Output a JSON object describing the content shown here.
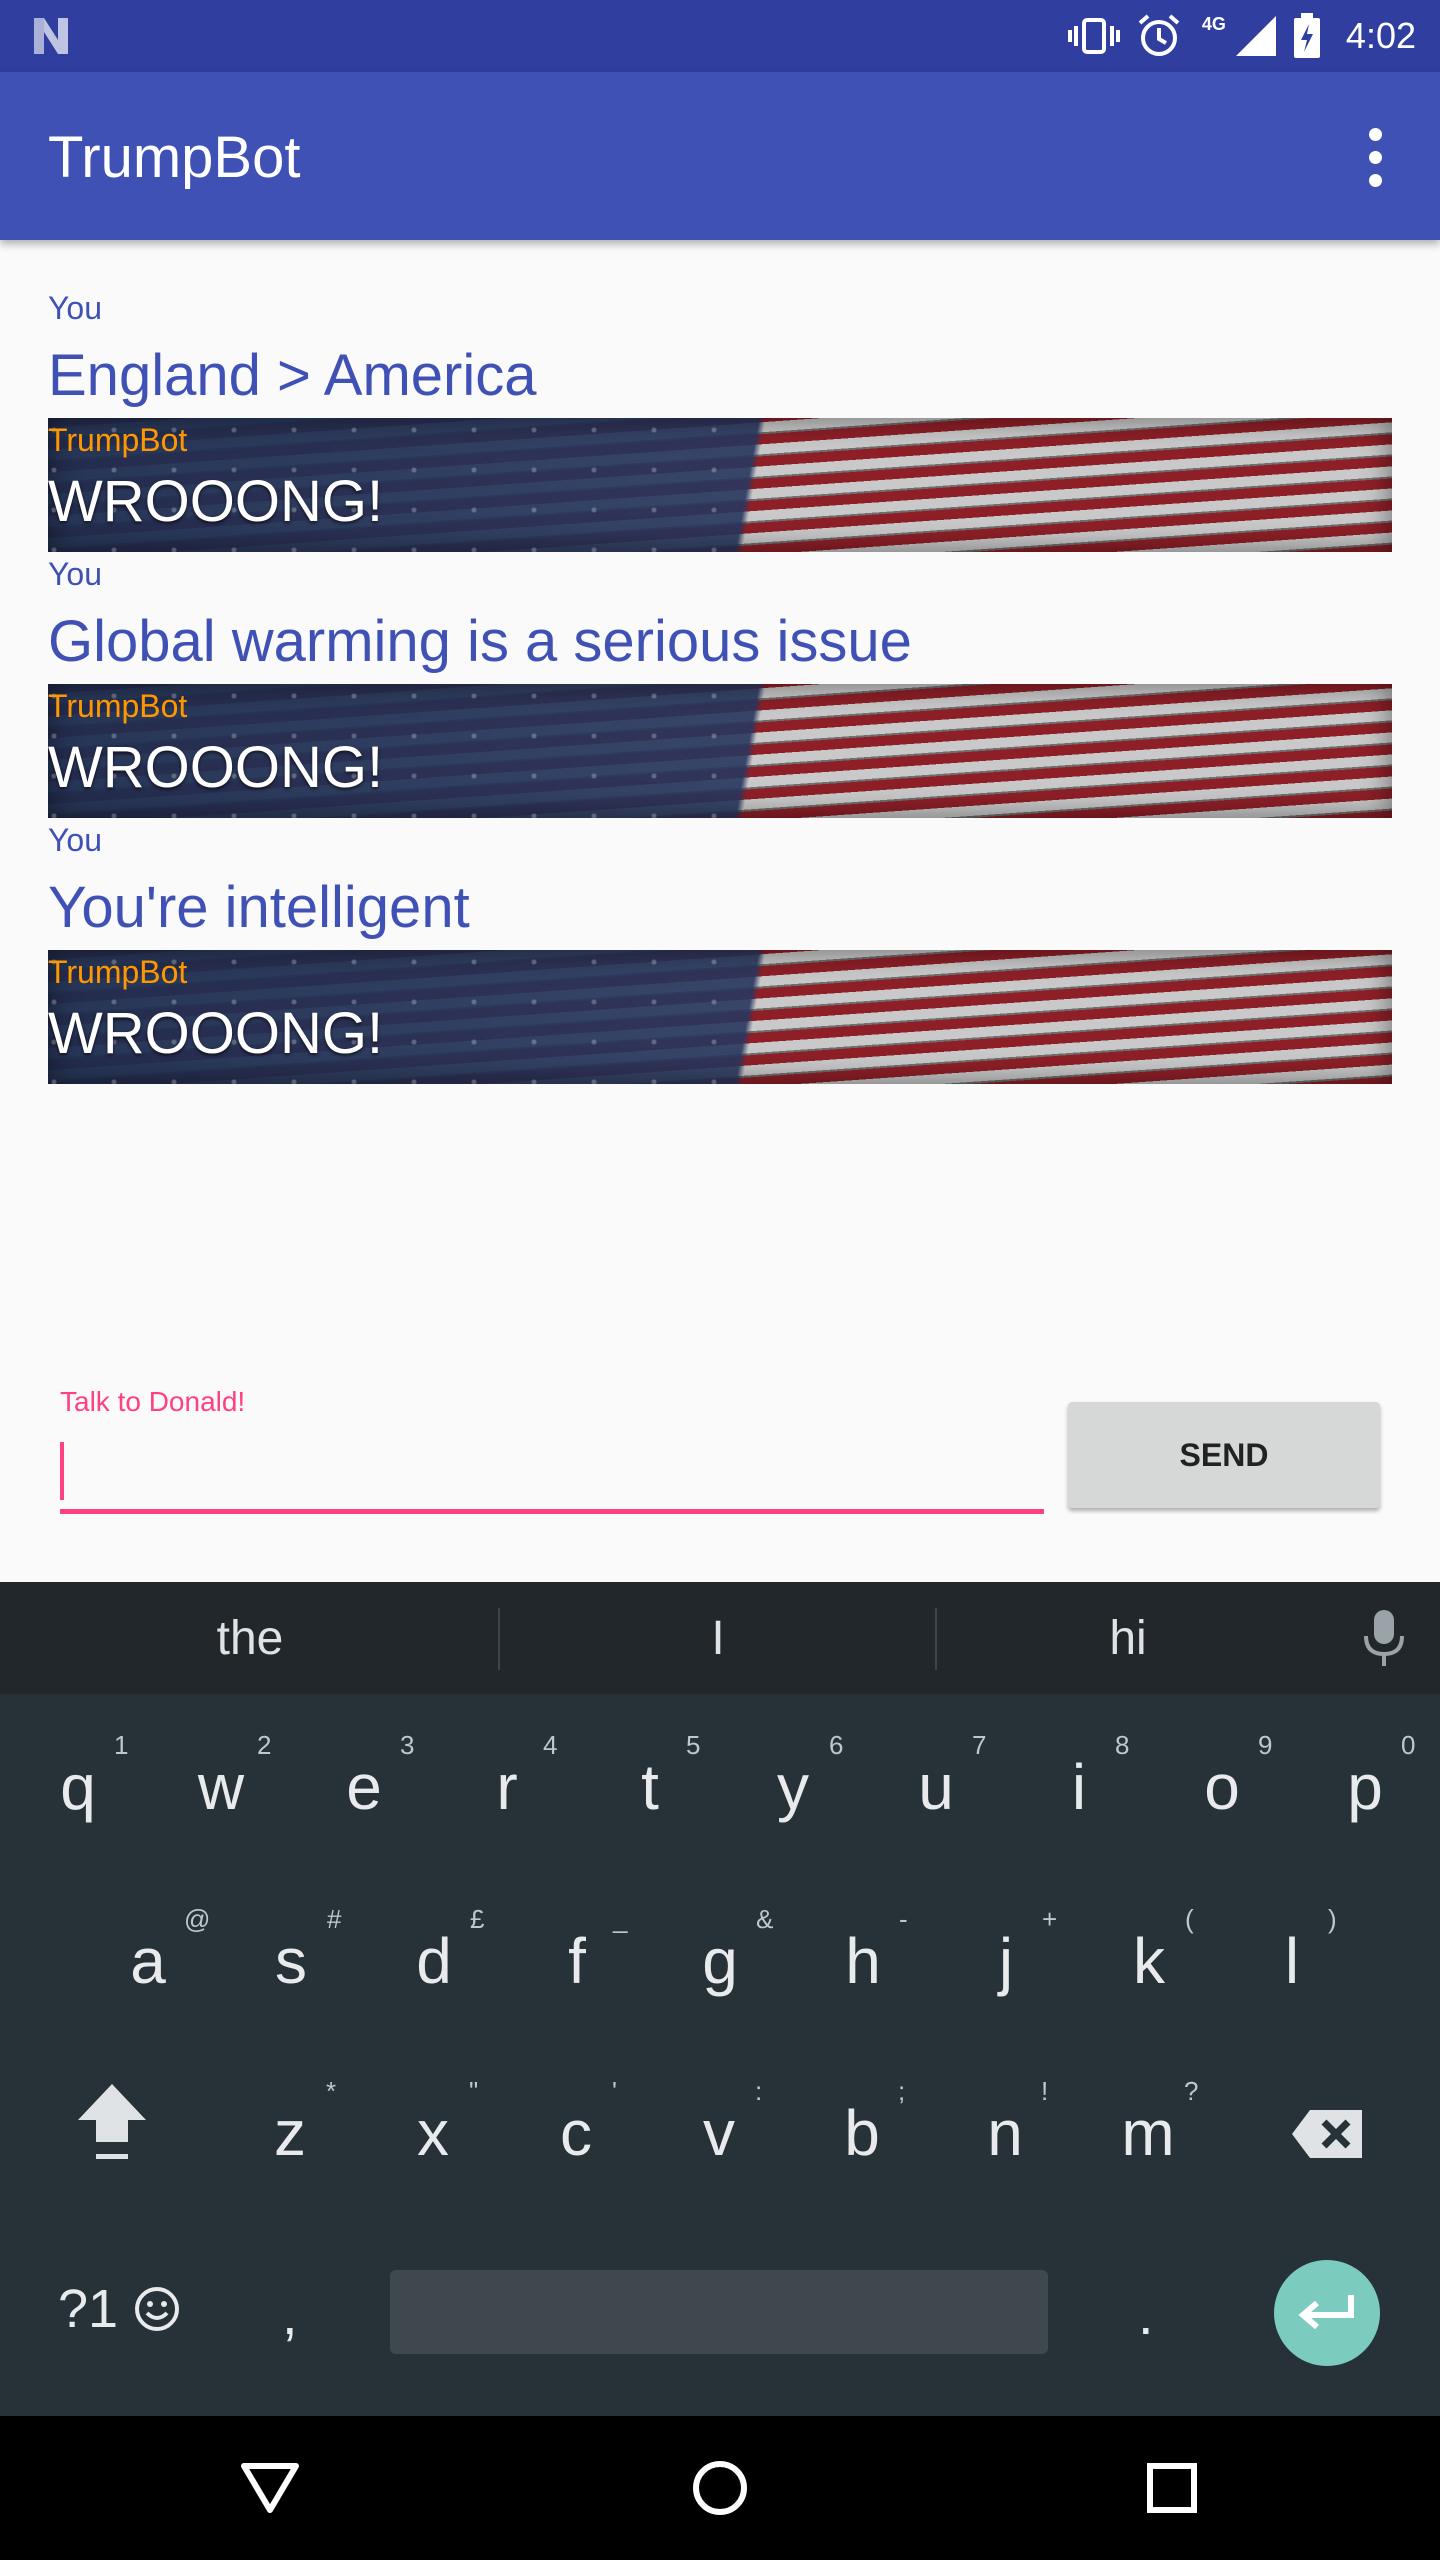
{
  "status_bar": {
    "time": "4:02",
    "network": "4G"
  },
  "app_bar": {
    "title": "TrumpBot"
  },
  "messages": [
    {
      "sender": "You",
      "text": "England > America",
      "type": "user"
    },
    {
      "sender": "TrumpBot",
      "text": "WROOONG!",
      "type": "bot"
    },
    {
      "sender": "You",
      "text": "Global warming is a serious issue",
      "type": "user"
    },
    {
      "sender": "TrumpBot",
      "text": "WROOONG!",
      "type": "bot"
    },
    {
      "sender": "You",
      "text": "You're intelligent",
      "type": "user"
    },
    {
      "sender": "TrumpBot",
      "text": "WROOONG!",
      "type": "bot"
    }
  ],
  "input": {
    "label": "Talk to Donald!",
    "value": ""
  },
  "send_button": {
    "label": "SEND"
  },
  "keyboard": {
    "suggestions": [
      "the",
      "I",
      "hi"
    ],
    "row1": [
      {
        "key": "q",
        "hint": "1"
      },
      {
        "key": "w",
        "hint": "2"
      },
      {
        "key": "e",
        "hint": "3"
      },
      {
        "key": "r",
        "hint": "4"
      },
      {
        "key": "t",
        "hint": "5"
      },
      {
        "key": "y",
        "hint": "6"
      },
      {
        "key": "u",
        "hint": "7"
      },
      {
        "key": "i",
        "hint": "8"
      },
      {
        "key": "o",
        "hint": "9"
      },
      {
        "key": "p",
        "hint": "0"
      }
    ],
    "row2": [
      {
        "key": "a",
        "hint": "@"
      },
      {
        "key": "s",
        "hint": "#"
      },
      {
        "key": "d",
        "hint": "£"
      },
      {
        "key": "f",
        "hint": "_"
      },
      {
        "key": "g",
        "hint": "&"
      },
      {
        "key": "h",
        "hint": "-"
      },
      {
        "key": "j",
        "hint": "+"
      },
      {
        "key": "k",
        "hint": "("
      },
      {
        "key": "l",
        "hint": ")"
      }
    ],
    "row3": [
      {
        "key": "z",
        "hint": "*"
      },
      {
        "key": "x",
        "hint": "\""
      },
      {
        "key": "c",
        "hint": "'"
      },
      {
        "key": "v",
        "hint": ":"
      },
      {
        "key": "b",
        "hint": ";"
      },
      {
        "key": "n",
        "hint": "!"
      },
      {
        "key": "m",
        "hint": "?"
      }
    ],
    "symbols_label": "?1",
    "comma": ",",
    "period": "."
  },
  "colors": {
    "primary": "#3f51b5",
    "primary_dark": "#303f9f",
    "accent": "#ff4081",
    "bot_label": "#ff9800",
    "enter_key": "#7ccbbf"
  },
  "icons": {
    "status": [
      "vibrate-icon",
      "alarm-icon",
      "signal-icon",
      "battery-charging-icon"
    ],
    "nav": [
      "back-icon",
      "home-icon",
      "recents-icon"
    ]
  }
}
